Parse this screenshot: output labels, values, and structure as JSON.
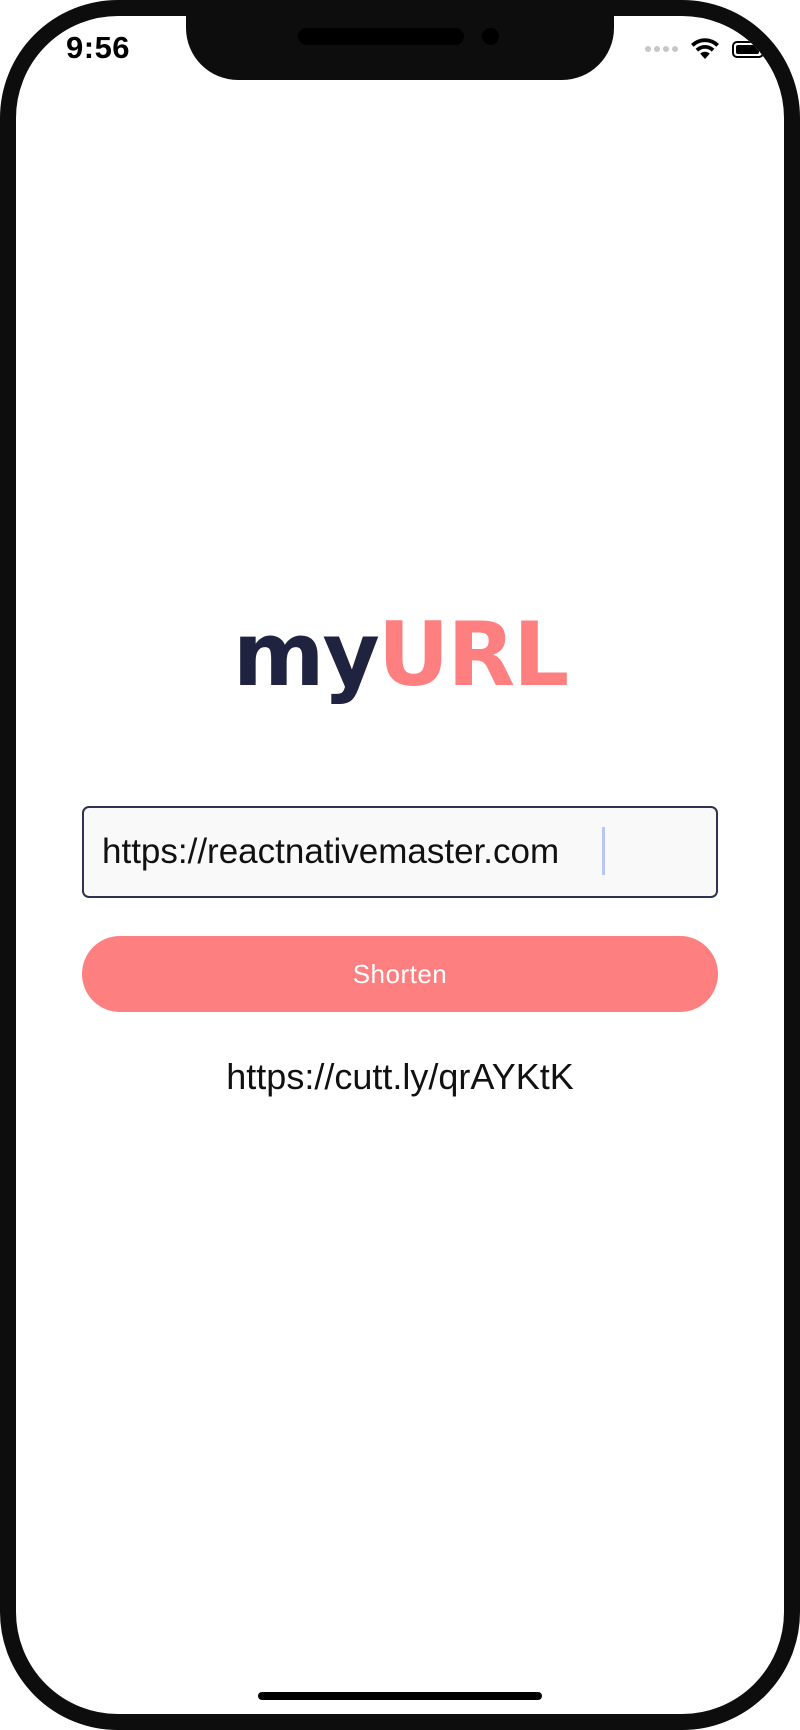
{
  "status_bar": {
    "time": "9:56",
    "wifi_icon": "wifi-icon",
    "battery_icon": "battery-icon",
    "signal_icon": "cellular-signal-icon"
  },
  "app": {
    "logo_part1": "my",
    "logo_part2": "URL",
    "colors": {
      "dark": "#1f2340",
      "accent": "#fe7f7f"
    }
  },
  "form": {
    "url_value": "https://reactnativemaster.com",
    "shorten_label": "Shorten"
  },
  "result": {
    "short_url": "https://cutt.ly/qrAYKtK"
  }
}
